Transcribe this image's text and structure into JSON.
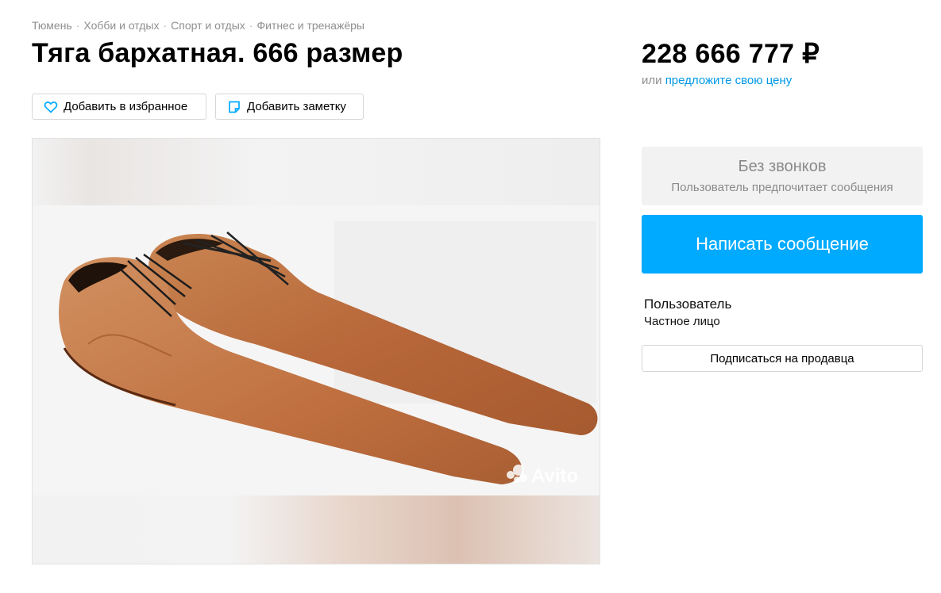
{
  "breadcrumbs": [
    "Тюмень",
    "Хобби и отдых",
    "Спорт и отдых",
    "Фитнес и тренажёры"
  ],
  "breadcrumb_separator": "·",
  "listing": {
    "title": "Тяга бархатная. 666 размер",
    "price": "228 666 777 ₽",
    "offer_prefix": "или",
    "offer_link": "предложите свою цену"
  },
  "actions": {
    "favorite_label": "Добавить в избранное",
    "note_label": "Добавить заметку"
  },
  "gallery": {
    "watermark": "Avito",
    "image_subject": "shoes"
  },
  "contact": {
    "no_calls_title": "Без звонков",
    "no_calls_subtitle": "Пользователь предпочитает сообщения",
    "message_button": "Написать сообщение"
  },
  "seller": {
    "name": "Пользователь",
    "type": "Частное лицо",
    "subscribe_button": "Подписаться на продавца"
  },
  "colors": {
    "accent": "#00aaff",
    "link": "#0099e6",
    "muted_text": "#8f8f8f",
    "leather": "#b8683a"
  },
  "icons": [
    "heart-icon",
    "note-icon"
  ]
}
